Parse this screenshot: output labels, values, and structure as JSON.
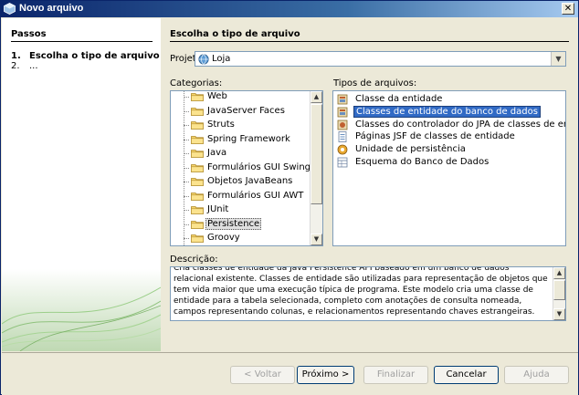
{
  "window": {
    "title": "Novo arquivo",
    "close_glyph": "✕"
  },
  "steps": {
    "title": "Passos",
    "items": [
      {
        "num": "1.",
        "label": "Escolha o tipo de arquivo"
      },
      {
        "num": "2.",
        "label": "..."
      }
    ]
  },
  "main": {
    "title": "Escolha o tipo de arquivo",
    "project_label": "Projeto:",
    "project_value": "Loja",
    "categories_label": "Categorias:",
    "categories": [
      "Web",
      "JavaServer Faces",
      "Struts",
      "Spring Framework",
      "Java",
      "Formulários GUI Swing",
      "Objetos JavaBeans",
      "Formulários GUI AWT",
      "JUnit",
      "Persistence",
      "Groovy"
    ],
    "selected_category": "Persistence",
    "file_types_label": "Tipos de arquivos:",
    "file_types": [
      {
        "label": "Classe da entidade",
        "icon": "entity-class-icon"
      },
      {
        "label": "Classes de entidade do banco de dados",
        "icon": "entity-db-icon"
      },
      {
        "label": "Classes do controlador do JPA de classes de entidade",
        "icon": "jpa-controller-icon"
      },
      {
        "label": "Páginas JSF de classes de entidade",
        "icon": "jsf-pages-icon"
      },
      {
        "label": "Unidade de persistência",
        "icon": "persistence-unit-icon"
      },
      {
        "label": "Esquema do Banco de Dados",
        "icon": "db-schema-icon"
      }
    ],
    "selected_file_type": "Classes de entidade do banco de dados",
    "description_label": "Descrição:",
    "description": "Cria classes de entidade da Java Persistence API baseado em um banco de dados relacional existente. Classes de entidade são utilizadas para representação de objetos que tem vida maior que uma execução típica de programa. Este modelo cria uma classe de entidade para a tabela selecionada, completo com anotações de consulta nomeada, campos representando colunas, e relacionamentos representando chaves estrangeiras."
  },
  "buttons": {
    "back": "< Voltar",
    "next": "Próximo >",
    "finish": "Finalizar",
    "cancel": "Cancelar",
    "help": "Ajuda"
  },
  "colors": {
    "selection": "#316ac5",
    "title_bar": "#0a246a",
    "dialog_bg": "#ece9d8"
  }
}
